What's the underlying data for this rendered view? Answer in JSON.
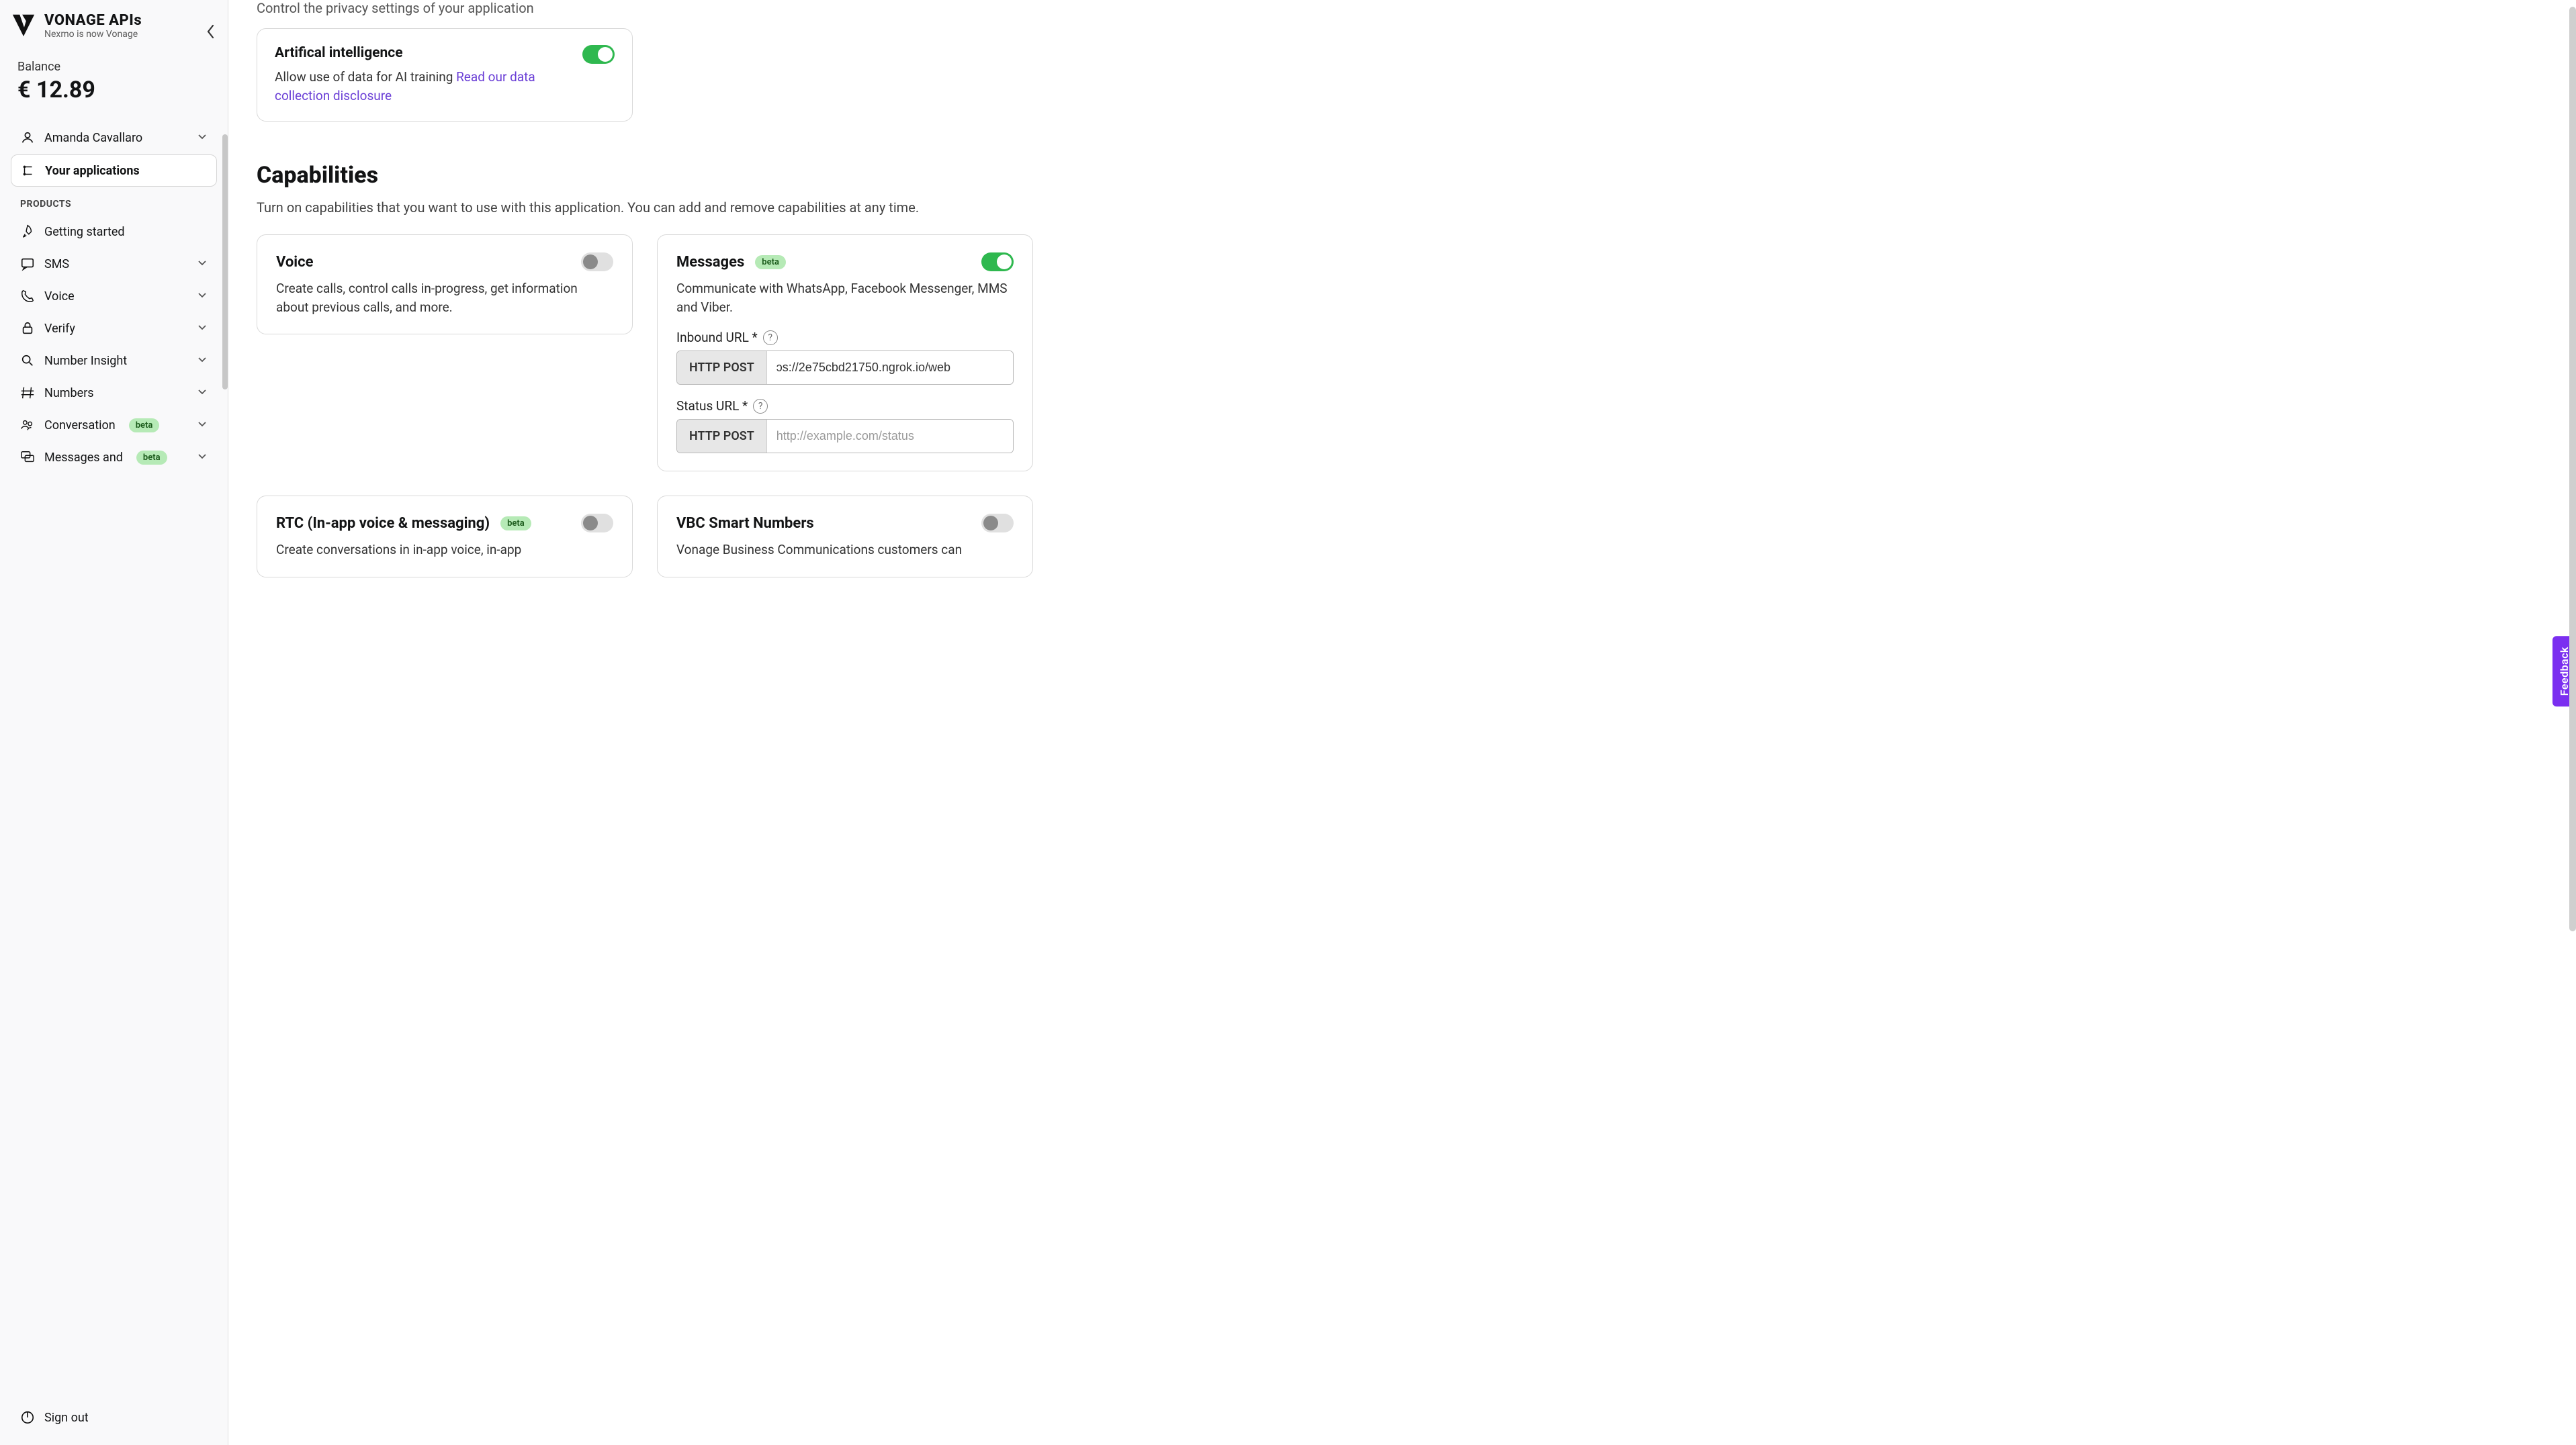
{
  "brand": {
    "title": "VONAGE APIs",
    "sub": "Nexmo is now Vonage"
  },
  "balance": {
    "label": "Balance",
    "amount": "€ 12.89"
  },
  "sidebar": {
    "user": "Amanda Cavallaro",
    "active": "Your applications",
    "products_label": "PRODUCTS",
    "items": {
      "getting_started": "Getting started",
      "sms": "SMS",
      "voice": "Voice",
      "verify": "Verify",
      "number_insight": "Number Insight",
      "numbers": "Numbers",
      "conversation": "Conversation",
      "messages_and": "Messages and"
    },
    "beta": "beta",
    "sign_out": "Sign out"
  },
  "privacy": {
    "caption": "Control the privacy settings of your application",
    "ai_title": "Artifical intelligence",
    "ai_desc": "Allow use of data for AI training ",
    "ai_link": "Read our data collection disclosure"
  },
  "capabilities": {
    "title": "Capabilities",
    "sub": "Turn on capabilities that you want to use with this application. You can add and remove capabilities at any time.",
    "voice": {
      "name": "Voice",
      "desc": "Create calls, control calls in-progress, get information about previous calls, and more."
    },
    "messages": {
      "name": "Messages",
      "desc": "Communicate with WhatsApp, Facebook Messenger, MMS and Viber.",
      "inbound_label": "Inbound URL *",
      "inbound_method": "HTTP POST",
      "inbound_value": "ɔs://2e75cbd21750.ngrok.io/web",
      "status_label": "Status URL *",
      "status_method": "HTTP POST",
      "status_placeholder": "http://example.com/status"
    },
    "rtc": {
      "name": "RTC (In-app voice & messaging)",
      "desc": "Create conversations in in-app voice, in-app"
    },
    "vbc": {
      "name": "VBC Smart Numbers",
      "desc": "Vonage Business Communications customers can"
    }
  },
  "feedback": "Feedback"
}
